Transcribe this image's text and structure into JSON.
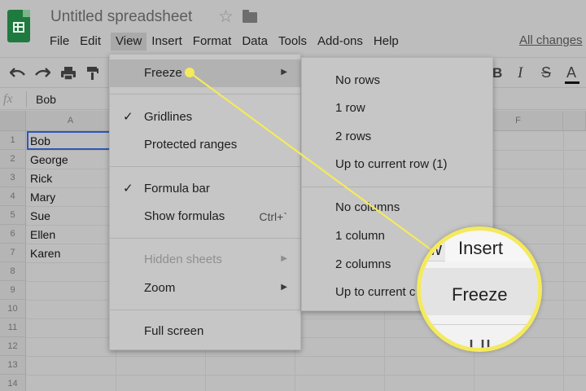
{
  "app": {
    "title": "Untitled spreadsheet",
    "all_changes": "All changes"
  },
  "menubar": {
    "items": [
      "File",
      "Edit",
      "View",
      "Insert",
      "Format",
      "Data",
      "Tools",
      "Add-ons",
      "Help"
    ],
    "active": "View"
  },
  "toolbar": {
    "bold": "B",
    "italic": "I",
    "strike": "S",
    "text_color": "A"
  },
  "formula_bar": {
    "fx": "fx",
    "value": "Bob"
  },
  "columns": [
    "A",
    "F"
  ],
  "rows": [
    "1",
    "2",
    "3",
    "4",
    "5",
    "6",
    "7",
    "8",
    "9",
    "10",
    "11",
    "12",
    "13",
    "14"
  ],
  "cells": [
    "Bob",
    "George",
    "Rick",
    "Mary",
    "Sue",
    "Ellen",
    "Karen"
  ],
  "view_menu": {
    "freeze": "Freeze",
    "gridlines": "Gridlines",
    "protected_ranges": "Protected ranges",
    "formula_bar": "Formula bar",
    "show_formulas": "Show formulas",
    "show_formulas_shortcut": "Ctrl+`",
    "hidden_sheets": "Hidden sheets",
    "zoom": "Zoom",
    "full_screen": "Full screen"
  },
  "freeze_submenu": {
    "no_rows": "No rows",
    "one_row": "1 row",
    "two_rows": "2 rows",
    "up_to_row": "Up to current row (1)",
    "no_columns": "No columns",
    "one_column": "1 column",
    "two_columns": "2 columns",
    "up_to_column": "Up to current c"
  },
  "zoom_callout": {
    "menu_fragment": "w",
    "insert": "Insert",
    "freeze": "Freeze"
  },
  "colors": {
    "highlight": "#f4ea5c",
    "logo_green": "#1e7a3e",
    "selection": "#2c58b8"
  }
}
